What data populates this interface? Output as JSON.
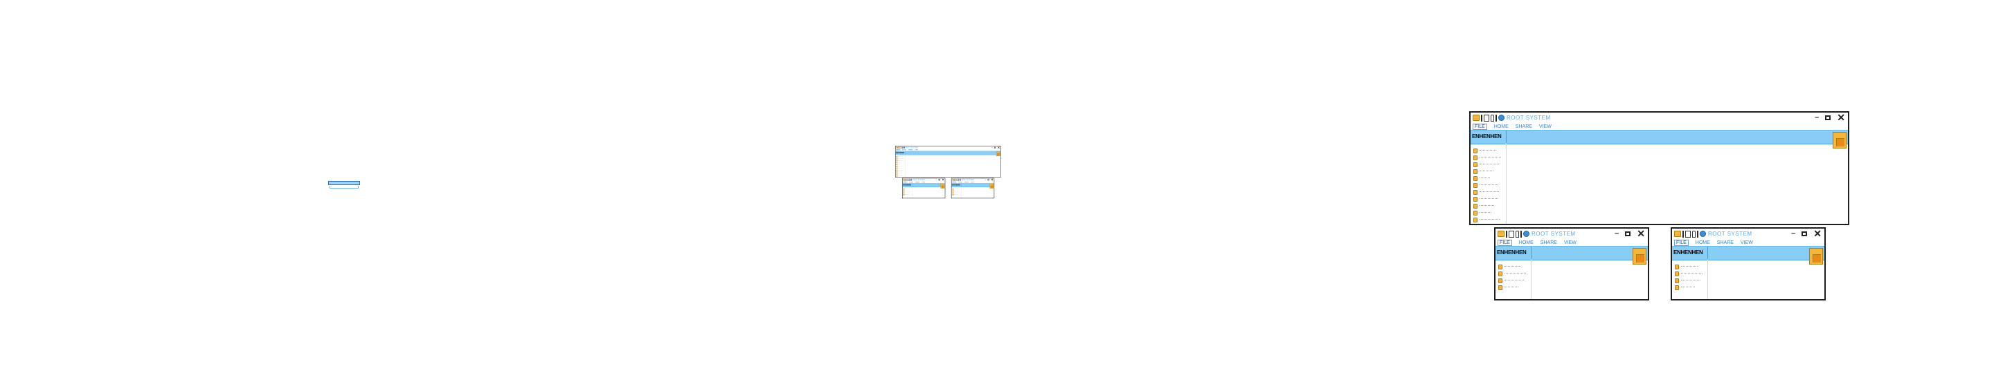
{
  "title_text": "ROOT SYSTEM",
  "menu": [
    "FILE",
    "HOME",
    "SHARE",
    "VIEW"
  ],
  "ribbon_lead": "ENHENHEN",
  "controls": {
    "minimize": "–",
    "close": "✕"
  },
  "main_tree": [
    "",
    "",
    "",
    "",
    "",
    "",
    "",
    "",
    "",
    "",
    "",
    ""
  ],
  "small_tree": [
    "",
    "",
    "",
    ""
  ],
  "colors": {
    "ribbon": "#87cdf6",
    "folder": "#f4b63c",
    "title": "#5aa7e6",
    "border": "#1e1e1e"
  },
  "icons": [
    "folder-icon",
    "document-icon",
    "pen-icon",
    "globe-icon",
    "minimize-icon",
    "maximize-icon",
    "close-icon"
  ]
}
